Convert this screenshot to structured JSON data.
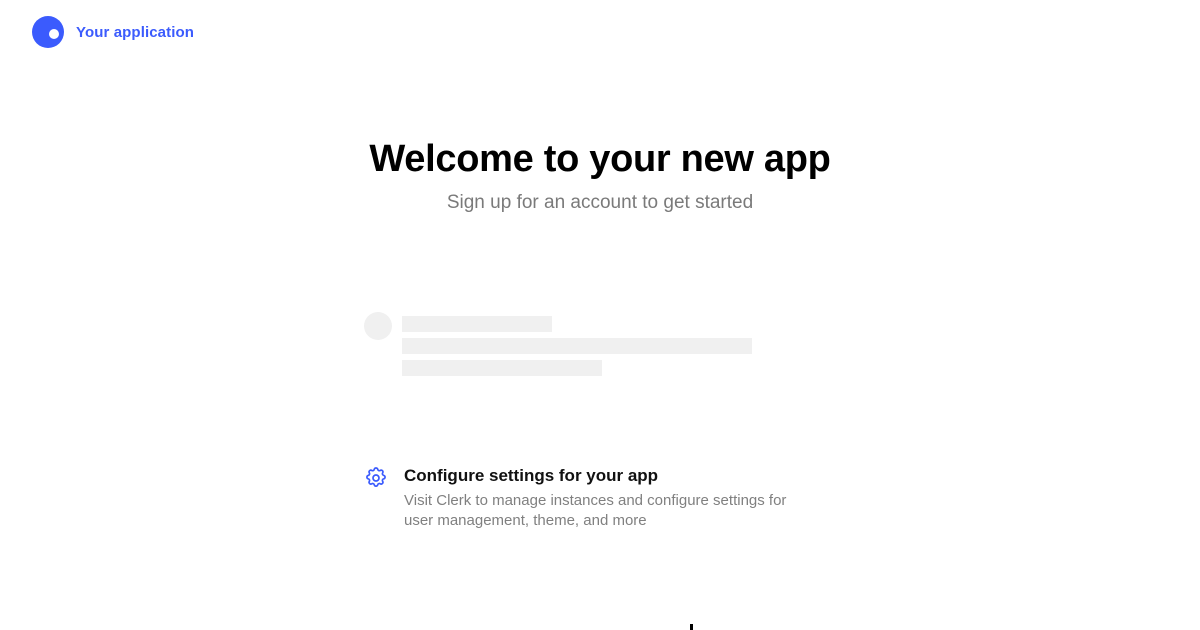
{
  "brand": {
    "name": "Your application",
    "logo_icon": "clerk-logo-icon",
    "color": "#3b5bfd"
  },
  "hero": {
    "title": "Welcome to your new app",
    "subtitle": "Sign up for an account to get started"
  },
  "skeleton": {
    "state": "loading",
    "line_count": 3
  },
  "configure": {
    "icon": "gear-icon",
    "title": "Configure settings for your app",
    "description": "Visit Clerk to manage instances and configure settings for user management, theme, and more"
  }
}
